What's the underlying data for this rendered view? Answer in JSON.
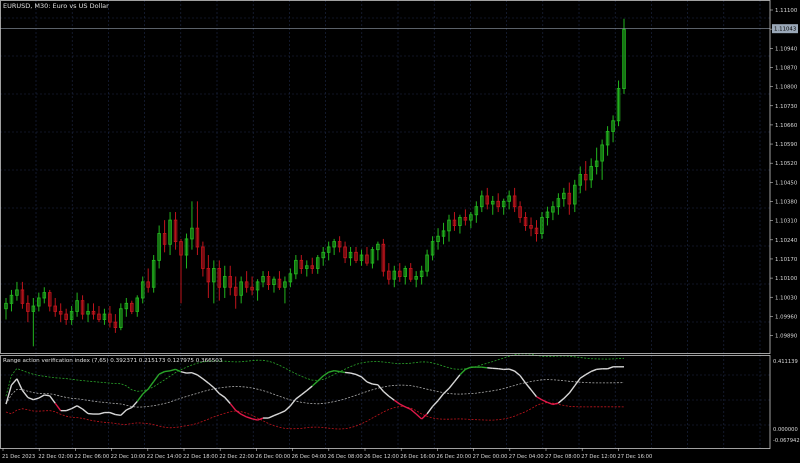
{
  "window": {
    "symbol_title": "EURUSD, M30:  Euro vs US Dollar",
    "indicator_title": "Range action verification index (7,65) 0.392371 0.215173 0.127975 0.366503"
  },
  "colors": {
    "background": "#000000",
    "grid": "#1f2a48",
    "bull_candle": "#22b51e",
    "bear_candle": "#c0141c",
    "doji": "#d8d8d8",
    "axis_text": "#d8d8d8",
    "bid_line": "#8f9aa7",
    "price_label_bg": "#9aa8b8",
    "osc_bull": "#2aa52a",
    "osc_bear": "#e0194a",
    "osc_neutral": "#d8d8d8",
    "band_upper": "#2aa52a",
    "band_lower": "#c0141c",
    "band_mid": "#aaaaaa"
  },
  "price_axis": {
    "labels": [
      "1.11100",
      "1.11010",
      "1.10940",
      "1.10870",
      "1.10800",
      "1.10730",
      "1.10660",
      "1.10590",
      "1.10520",
      "1.10450",
      "1.10380",
      "1.10310",
      "1.10240",
      "1.10170",
      "1.10100",
      "1.10030",
      "1.09960",
      "1.09890"
    ],
    "current_price": "1.11043"
  },
  "indicator_axis": {
    "labels": [
      "0.411139",
      "0.000000",
      "-0.067942"
    ]
  },
  "time_axis": {
    "labels": [
      "21 Dec 2023",
      "22 Dec 02:00",
      "22 Dec 06:00",
      "22 Dec 10:00",
      "22 Dec 14:00",
      "22 Dec 18:00",
      "22 Dec 22:00",
      "26 Dec 00:00",
      "26 Dec 04:00",
      "26 Dec 08:00",
      "26 Dec 12:00",
      "26 Dec 16:00",
      "26 Dec 20:00",
      "27 Dec 00:00",
      "27 Dec 04:00",
      "27 Dec 08:00",
      "27 Dec 12:00",
      "27 Dec 16:00"
    ]
  },
  "chart_data": {
    "type": "candlestick",
    "symbol": "EURUSD",
    "timeframe": "M30",
    "title": "EURUSD, M30:  Euro vs US Dollar",
    "ylim": [
      1.0985,
      1.1112
    ],
    "candles_ohlc": [
      [
        1.1,
        1.1004,
        1.0996,
        1.1002
      ],
      [
        1.1002,
        1.1007,
        1.0999,
        1.1005
      ],
      [
        1.1005,
        1.101,
        1.1003,
        1.1007
      ],
      [
        1.1007,
        1.101,
        1.1,
        1.1002
      ],
      [
        1.1002,
        1.1005,
        1.0995,
        1.0999
      ],
      [
        1.0999,
        1.1004,
        1.0986,
        1.1001
      ],
      [
        1.1001,
        1.1006,
        1.0999,
        1.1004
      ],
      [
        1.1004,
        1.1008,
        1.1002,
        1.1006
      ],
      [
        1.1006,
        1.1007,
        1.0999,
        1.1001
      ],
      [
        1.1001,
        1.1004,
        1.0997,
        1.0999
      ],
      [
        1.0999,
        1.1002,
        1.0995,
        1.0998
      ],
      [
        1.0998,
        1.1,
        1.0994,
        1.0996
      ],
      [
        1.0996,
        1.1001,
        1.0994,
        1.0999
      ],
      [
        1.0999,
        1.1006,
        1.0997,
        1.1003
      ],
      [
        1.1003,
        1.1005,
        1.0996,
        1.0998
      ],
      [
        1.0998,
        1.1002,
        1.0995,
        1.0999
      ],
      [
        1.0999,
        1.1002,
        1.0996,
        1.0998
      ],
      [
        1.0998,
        1.1001,
        1.0995,
        1.0996
      ],
      [
        1.0996,
        1.1,
        1.0994,
        1.0998
      ],
      [
        1.0998,
        1.1001,
        1.0993,
        1.0995
      ],
      [
        1.0995,
        1.0998,
        1.0991,
        1.0993
      ],
      [
        1.0993,
        1.1002,
        1.0992,
        1.1
      ],
      [
        1.1,
        1.1004,
        1.0997,
        1.1002
      ],
      [
        1.1002,
        1.1003,
        1.0998,
        1.0999
      ],
      [
        1.0999,
        1.1005,
        1.0997,
        1.1004
      ],
      [
        1.1004,
        1.1012,
        1.1002,
        1.101
      ],
      [
        1.101,
        1.1015,
        1.1006,
        1.1008
      ],
      [
        1.1008,
        1.102,
        1.1006,
        1.1018
      ],
      [
        1.1018,
        1.1031,
        1.1015,
        1.1028
      ],
      [
        1.1028,
        1.1033,
        1.1021,
        1.1024
      ],
      [
        1.1024,
        1.1036,
        1.102,
        1.1033
      ],
      [
        1.1033,
        1.1036,
        1.1022,
        1.1025
      ],
      [
        1.1025,
        1.1026,
        1.1002,
        1.102
      ],
      [
        1.102,
        1.1028,
        1.1015,
        1.1026
      ],
      [
        1.1026,
        1.104,
        1.1022,
        1.103
      ],
      [
        1.103,
        1.104,
        1.102,
        1.1023
      ],
      [
        1.1023,
        1.1025,
        1.1012,
        1.1015
      ],
      [
        1.1015,
        1.102,
        1.1004,
        1.101
      ],
      [
        1.101,
        1.1018,
        1.1002,
        1.1015
      ],
      [
        1.1015,
        1.1018,
        1.1003,
        1.1008
      ],
      [
        1.1008,
        1.1016,
        1.1004,
        1.1012
      ],
      [
        1.1012,
        1.1016,
        1.1005,
        1.1008
      ],
      [
        1.1008,
        1.1012,
        1.1,
        1.1005
      ],
      [
        1.1005,
        1.1012,
        1.1002,
        1.101
      ],
      [
        1.101,
        1.1014,
        1.1006,
        1.1008
      ],
      [
        1.1008,
        1.1012,
        1.1005,
        1.1007
      ],
      [
        1.1007,
        1.1011,
        1.1003,
        1.101
      ],
      [
        1.101,
        1.1014,
        1.1008,
        1.1012
      ],
      [
        1.1012,
        1.1014,
        1.1007,
        1.1009
      ],
      [
        1.1009,
        1.1012,
        1.1006,
        1.1011
      ],
      [
        1.1011,
        1.1014,
        1.1007,
        1.1008
      ],
      [
        1.1008,
        1.1012,
        1.1002,
        1.101
      ],
      [
        1.101,
        1.1015,
        1.1008,
        1.1013
      ],
      [
        1.1013,
        1.102,
        1.1011,
        1.1018
      ],
      [
        1.1018,
        1.102,
        1.1013,
        1.1015
      ],
      [
        1.1015,
        1.1018,
        1.1012,
        1.1016
      ],
      [
        1.1016,
        1.1019,
        1.1013,
        1.1015
      ],
      [
        1.1015,
        1.102,
        1.1013,
        1.1019
      ],
      [
        1.1019,
        1.1023,
        1.1016,
        1.1021
      ],
      [
        1.1021,
        1.1025,
        1.1018,
        1.1023
      ],
      [
        1.1023,
        1.1026,
        1.102,
        1.1025
      ],
      [
        1.1025,
        1.1027,
        1.1021,
        1.1023
      ],
      [
        1.1023,
        1.1025,
        1.1017,
        1.1019
      ],
      [
        1.1019,
        1.1023,
        1.1016,
        1.1021
      ],
      [
        1.1021,
        1.1023,
        1.1017,
        1.1018
      ],
      [
        1.1018,
        1.1022,
        1.1016,
        1.102
      ],
      [
        1.102,
        1.1023,
        1.1016,
        1.1017
      ],
      [
        1.1017,
        1.1023,
        1.1015,
        1.1022
      ],
      [
        1.1022,
        1.1025,
        1.1018,
        1.1024
      ],
      [
        1.1024,
        1.1026,
        1.1012,
        1.1014
      ],
      [
        1.1014,
        1.1017,
        1.1009,
        1.1011
      ],
      [
        1.1011,
        1.1016,
        1.1008,
        1.1014
      ],
      [
        1.1014,
        1.1017,
        1.101,
        1.1012
      ],
      [
        1.1012,
        1.1016,
        1.1009,
        1.1015
      ],
      [
        1.1015,
        1.1017,
        1.101,
        1.1011
      ],
      [
        1.1011,
        1.1014,
        1.1008,
        1.1012
      ],
      [
        1.1012,
        1.1016,
        1.1009,
        1.1014
      ],
      [
        1.1014,
        1.1022,
        1.1012,
        1.102
      ],
      [
        1.102,
        1.1027,
        1.1018,
        1.1025
      ],
      [
        1.1025,
        1.103,
        1.1022,
        1.1027
      ],
      [
        1.1027,
        1.1032,
        1.1024,
        1.1029
      ],
      [
        1.1029,
        1.1035,
        1.1025,
        1.1033
      ],
      [
        1.1033,
        1.1036,
        1.1029,
        1.1031
      ],
      [
        1.1031,
        1.1035,
        1.1028,
        1.1034
      ],
      [
        1.1034,
        1.1037,
        1.1031,
        1.1033
      ],
      [
        1.1033,
        1.1036,
        1.103,
        1.1035
      ],
      [
        1.1035,
        1.104,
        1.1032,
        1.1038
      ],
      [
        1.1038,
        1.1044,
        1.1036,
        1.1042
      ],
      [
        1.1042,
        1.1045,
        1.1037,
        1.1039
      ],
      [
        1.1039,
        1.1042,
        1.1035,
        1.104
      ],
      [
        1.104,
        1.1043,
        1.1036,
        1.1038
      ],
      [
        1.1038,
        1.1041,
        1.1035,
        1.104
      ],
      [
        1.104,
        1.1044,
        1.1037,
        1.1042
      ],
      [
        1.1042,
        1.1045,
        1.1036,
        1.1038
      ],
      [
        1.1038,
        1.104,
        1.1032,
        1.1034
      ],
      [
        1.1034,
        1.1036,
        1.1029,
        1.1031
      ],
      [
        1.1031,
        1.1034,
        1.1027,
        1.103
      ],
      [
        1.103,
        1.1033,
        1.1025,
        1.1028
      ],
      [
        1.1028,
        1.1036,
        1.1026,
        1.1034
      ],
      [
        1.1034,
        1.1038,
        1.1031,
        1.1036
      ],
      [
        1.1036,
        1.104,
        1.1033,
        1.1038
      ],
      [
        1.1038,
        1.1043,
        1.1035,
        1.1041
      ],
      [
        1.1041,
        1.1045,
        1.1038,
        1.1043
      ],
      [
        1.1043,
        1.1047,
        1.1035,
        1.1039
      ],
      [
        1.1039,
        1.1048,
        1.1036,
        1.1046
      ],
      [
        1.1046,
        1.1053,
        1.1043,
        1.105
      ],
      [
        1.105,
        1.1055,
        1.1044,
        1.1048
      ],
      [
        1.1048,
        1.1056,
        1.1045,
        1.1053
      ],
      [
        1.1053,
        1.106,
        1.105,
        1.1055
      ],
      [
        1.1055,
        1.1063,
        1.1048,
        1.1061
      ],
      [
        1.1061,
        1.1068,
        1.1057,
        1.1066
      ],
      [
        1.1066,
        1.1072,
        1.1062,
        1.107
      ],
      [
        1.107,
        1.1085,
        1.1068,
        1.1082
      ],
      [
        1.1082,
        1.1108,
        1.108,
        1.1104
      ]
    ],
    "indicator": {
      "name": "Range action verification index",
      "params": "(7,65)",
      "values": [
        0.392371,
        0.215173,
        0.127975,
        0.366503
      ],
      "ylim": [
        -0.067942,
        0.411139
      ]
    }
  }
}
